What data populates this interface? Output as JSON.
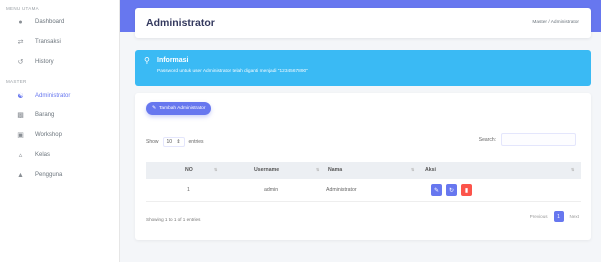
{
  "sidebar": {
    "section_main": "MENU UTAMA",
    "section_master": "MASTER",
    "items": [
      {
        "label": "Dashboard",
        "icon": "fire-icon"
      },
      {
        "label": "Transaksi",
        "icon": "exchange-icon"
      },
      {
        "label": "History",
        "icon": "history-icon"
      },
      {
        "label": "Administrator",
        "icon": "users-icon"
      },
      {
        "label": "Barang",
        "icon": "boxes-icon"
      },
      {
        "label": "Workshop",
        "icon": "workshop-icon"
      },
      {
        "label": "Kelas",
        "icon": "class-icon"
      },
      {
        "label": "Pengguna",
        "icon": "user-icon"
      }
    ]
  },
  "header": {
    "title": "Administrator",
    "breadcrumb": "Master / Administrator"
  },
  "alert": {
    "title": "Informasi",
    "message": "Password untuk user Administrator telah diganti menjadi \"1234567890\""
  },
  "card": {
    "add_button": "Tambah Administrator",
    "show_label": "Show",
    "entries_value": "10",
    "entries_label": "entries",
    "search_label": "Search:",
    "columns": [
      "NO",
      "Username",
      "Nama",
      "Aksi"
    ],
    "rows": [
      {
        "no": "1",
        "username": "admin",
        "nama": "Administrator"
      }
    ],
    "info": "Showing 1 to 1 of 1 entries",
    "prev": "Previous",
    "page": "1",
    "next": "Next"
  },
  "colors": {
    "primary": "#6777ef",
    "info": "#3abaf4",
    "warning": "#ffa426",
    "danger": "#fc544b"
  }
}
